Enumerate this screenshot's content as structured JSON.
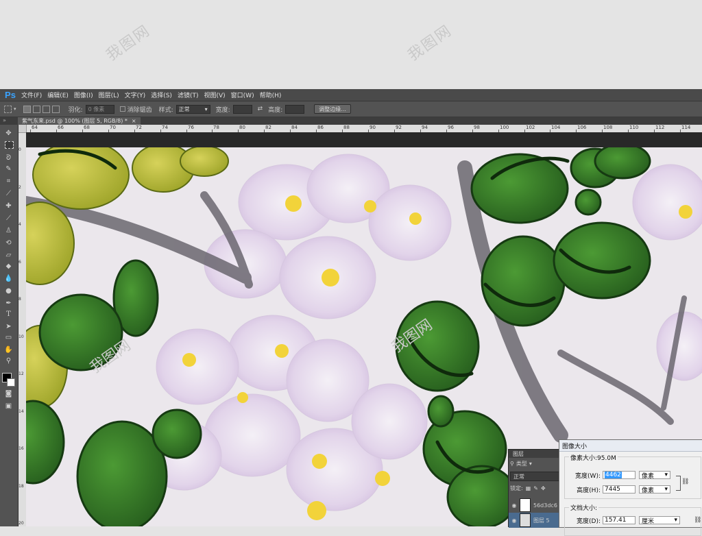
{
  "watermark": "我图网",
  "app": {
    "logo": "Ps",
    "menu": [
      "文件(F)",
      "编辑(E)",
      "图像(I)",
      "图层(L)",
      "文字(Y)",
      "选择(S)",
      "滤镜(T)",
      "视图(V)",
      "窗口(W)",
      "帮助(H)"
    ]
  },
  "options": {
    "feather_label": "羽化:",
    "feather_value": "0 像素",
    "antialias_label": "消除锯齿",
    "style_label": "样式:",
    "style_value": "正常",
    "width_label": "宽度:",
    "height_label": "高度:",
    "refine_button": "调整边缘..."
  },
  "document": {
    "tab_title": "紫气东来.psd @ 100% (图层 5, RGB/8) *",
    "ruler_top": [
      "64",
      "66",
      "68",
      "70",
      "72",
      "74",
      "76",
      "78",
      "80",
      "82",
      "84",
      "86",
      "88",
      "90",
      "92",
      "94",
      "96",
      "98",
      "100",
      "102",
      "104",
      "106",
      "108",
      "110",
      "112",
      "114"
    ],
    "ruler_left": [
      "0",
      "2",
      "4",
      "6",
      "8",
      "10",
      "12",
      "14",
      "16",
      "18",
      "20"
    ]
  },
  "layers_panel": {
    "title": "图层",
    "filter_value": "类型",
    "blend_mode": "正常",
    "lock_label": "锁定:",
    "layers": [
      {
        "name": "56d3dc6"
      },
      {
        "name": "图层 5"
      }
    ]
  },
  "image_size_dialog": {
    "title": "图像大小",
    "pixel_size_label": "像素大小:95.0M",
    "width_label": "宽度(W):",
    "width_value": "4462",
    "width_unit": "像素",
    "height_label": "高度(H):",
    "height_value": "7445",
    "height_unit": "像素",
    "doc_size_label": "文档大小:",
    "doc_width_label": "宽度(D):",
    "doc_width_value": "157.41",
    "doc_width_unit": "厘米"
  }
}
